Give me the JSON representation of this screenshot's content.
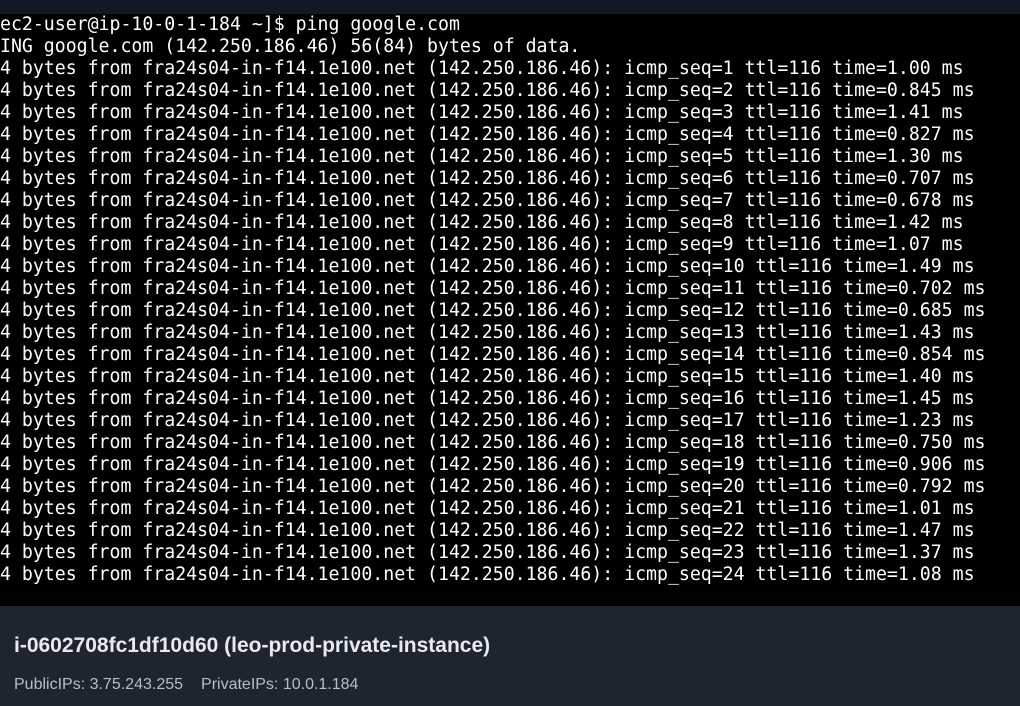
{
  "terminal": {
    "prompt_line": "ec2-user@ip-10-0-1-184 ~]$ ping google.com",
    "lines": [
      "ING google.com (142.250.186.46) 56(84) bytes of data.",
      "4 bytes from fra24s04-in-f14.1e100.net (142.250.186.46): icmp_seq=1 ttl=116 time=1.00 ms",
      "4 bytes from fra24s04-in-f14.1e100.net (142.250.186.46): icmp_seq=2 ttl=116 time=0.845 ms",
      "4 bytes from fra24s04-in-f14.1e100.net (142.250.186.46): icmp_seq=3 ttl=116 time=1.41 ms",
      "4 bytes from fra24s04-in-f14.1e100.net (142.250.186.46): icmp_seq=4 ttl=116 time=0.827 ms",
      "4 bytes from fra24s04-in-f14.1e100.net (142.250.186.46): icmp_seq=5 ttl=116 time=1.30 ms",
      "4 bytes from fra24s04-in-f14.1e100.net (142.250.186.46): icmp_seq=6 ttl=116 time=0.707 ms",
      "4 bytes from fra24s04-in-f14.1e100.net (142.250.186.46): icmp_seq=7 ttl=116 time=0.678 ms",
      "4 bytes from fra24s04-in-f14.1e100.net (142.250.186.46): icmp_seq=8 ttl=116 time=1.42 ms",
      "4 bytes from fra24s04-in-f14.1e100.net (142.250.186.46): icmp_seq=9 ttl=116 time=1.07 ms",
      "4 bytes from fra24s04-in-f14.1e100.net (142.250.186.46): icmp_seq=10 ttl=116 time=1.49 ms",
      "4 bytes from fra24s04-in-f14.1e100.net (142.250.186.46): icmp_seq=11 ttl=116 time=0.702 ms",
      "4 bytes from fra24s04-in-f14.1e100.net (142.250.186.46): icmp_seq=12 ttl=116 time=0.685 ms",
      "4 bytes from fra24s04-in-f14.1e100.net (142.250.186.46): icmp_seq=13 ttl=116 time=1.43 ms",
      "4 bytes from fra24s04-in-f14.1e100.net (142.250.186.46): icmp_seq=14 ttl=116 time=0.854 ms",
      "4 bytes from fra24s04-in-f14.1e100.net (142.250.186.46): icmp_seq=15 ttl=116 time=1.40 ms",
      "4 bytes from fra24s04-in-f14.1e100.net (142.250.186.46): icmp_seq=16 ttl=116 time=1.45 ms",
      "4 bytes from fra24s04-in-f14.1e100.net (142.250.186.46): icmp_seq=17 ttl=116 time=1.23 ms",
      "4 bytes from fra24s04-in-f14.1e100.net (142.250.186.46): icmp_seq=18 ttl=116 time=0.750 ms",
      "4 bytes from fra24s04-in-f14.1e100.net (142.250.186.46): icmp_seq=19 ttl=116 time=0.906 ms",
      "4 bytes from fra24s04-in-f14.1e100.net (142.250.186.46): icmp_seq=20 ttl=116 time=0.792 ms",
      "4 bytes from fra24s04-in-f14.1e100.net (142.250.186.46): icmp_seq=21 ttl=116 time=1.01 ms",
      "4 bytes from fra24s04-in-f14.1e100.net (142.250.186.46): icmp_seq=22 ttl=116 time=1.47 ms",
      "4 bytes from fra24s04-in-f14.1e100.net (142.250.186.46): icmp_seq=23 ttl=116 time=1.37 ms",
      "4 bytes from fra24s04-in-f14.1e100.net (142.250.186.46): icmp_seq=24 ttl=116 time=1.08 ms"
    ]
  },
  "instance": {
    "title": "i-0602708fc1df10d60 (leo-prod-private-instance)",
    "public_ips": "PublicIPs: 3.75.243.255",
    "private_ips": "PrivateIPs: 10.0.1.184"
  },
  "colors": {
    "terminal_bg": "#000000",
    "terminal_fg": "#ffffff",
    "footer_bg": "#1e2530"
  }
}
